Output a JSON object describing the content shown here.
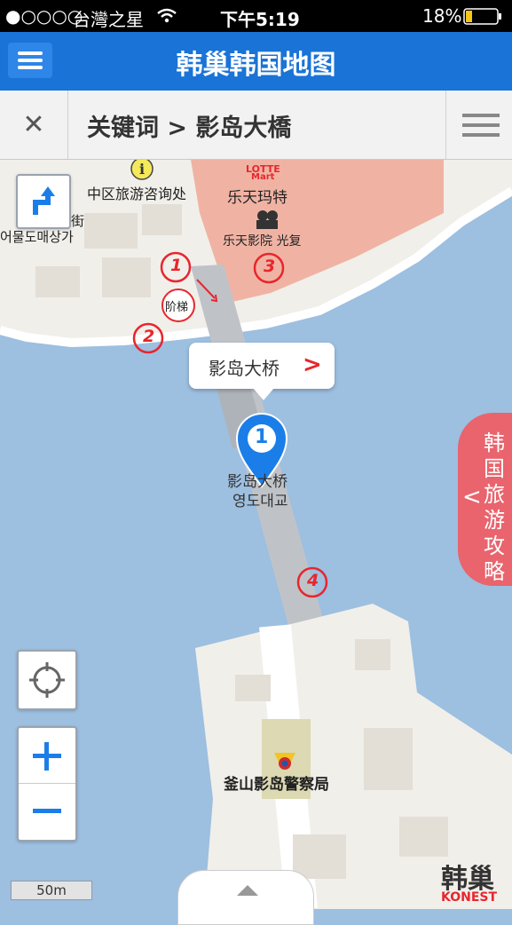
{
  "status_bar": {
    "signal": "●○○○○",
    "carrier": "台灣之星",
    "time": "下午5:19",
    "battery": "18%"
  },
  "app_bar": {
    "title": "韩巢韩国地图"
  },
  "search_bar": {
    "title": "关键词 > 影岛大橋"
  },
  "map": {
    "labels": {
      "info_center": "中区旅游咨询处",
      "lotte_logo_top": "LOTTE",
      "lotte_logo_bottom": "Mart",
      "lotte_mart": "乐天玛特",
      "lotte_cinema": "乐天影院 光复",
      "fish_market_cn": "街",
      "fish_market_kr": "어물도매상가",
      "bridge_cn": "影岛大桥",
      "bridge_kr": "영도대교",
      "police": "釜山影岛警察局",
      "stairs": "阶梯"
    },
    "annotations": [
      "1",
      "2",
      "3",
      "4"
    ],
    "marker_number": "1",
    "callout_label": "影岛大桥",
    "side_tab_label": "韩国旅游攻略",
    "scale": "50m",
    "watermark_cn": "韩巢",
    "watermark_en": "KONEST"
  },
  "colors": {
    "app_bar": "#1a73d6",
    "water": "#9dbfe0",
    "land": "#f1efea",
    "lotte_block": "#f0b3a3",
    "bridge": "#bfc3c8",
    "marker": "#1b7ee8",
    "annotation": "#e8262d",
    "side_tab": "#e9646d"
  },
  "icons": {
    "menu": "hamburger-icon",
    "close": "close-icon",
    "list": "list-icon",
    "directions": "directions-icon",
    "locate": "crosshair-icon",
    "zoom_in": "plus-icon",
    "zoom_out": "minus-icon",
    "info": "info-icon",
    "cinema": "cinema-icon",
    "police": "police-icon",
    "marker": "map-pin-icon"
  }
}
